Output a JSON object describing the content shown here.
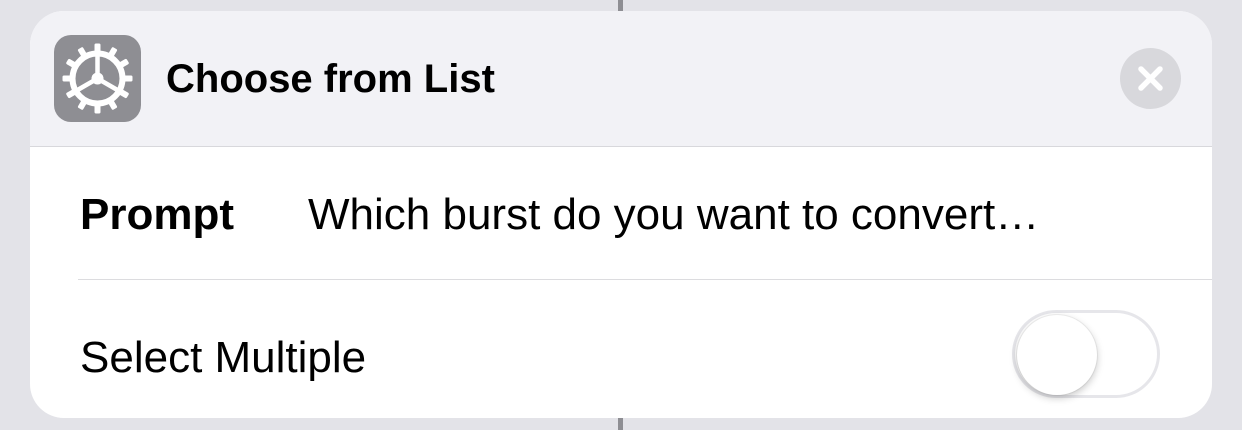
{
  "action": {
    "title": "Choose from List",
    "icon": "settings-gear-icon",
    "close_icon": "close-x-icon"
  },
  "parameters": {
    "prompt": {
      "label": "Prompt",
      "value": "Which burst do you want to convert…"
    },
    "select_multiple": {
      "label": "Select Multiple",
      "enabled": false
    }
  },
  "colors": {
    "background": "#e3e3e8",
    "card": "#ffffff",
    "header": "#f2f2f6",
    "icon_tile": "#8e8e93",
    "close_button": "#d8d8dc"
  }
}
